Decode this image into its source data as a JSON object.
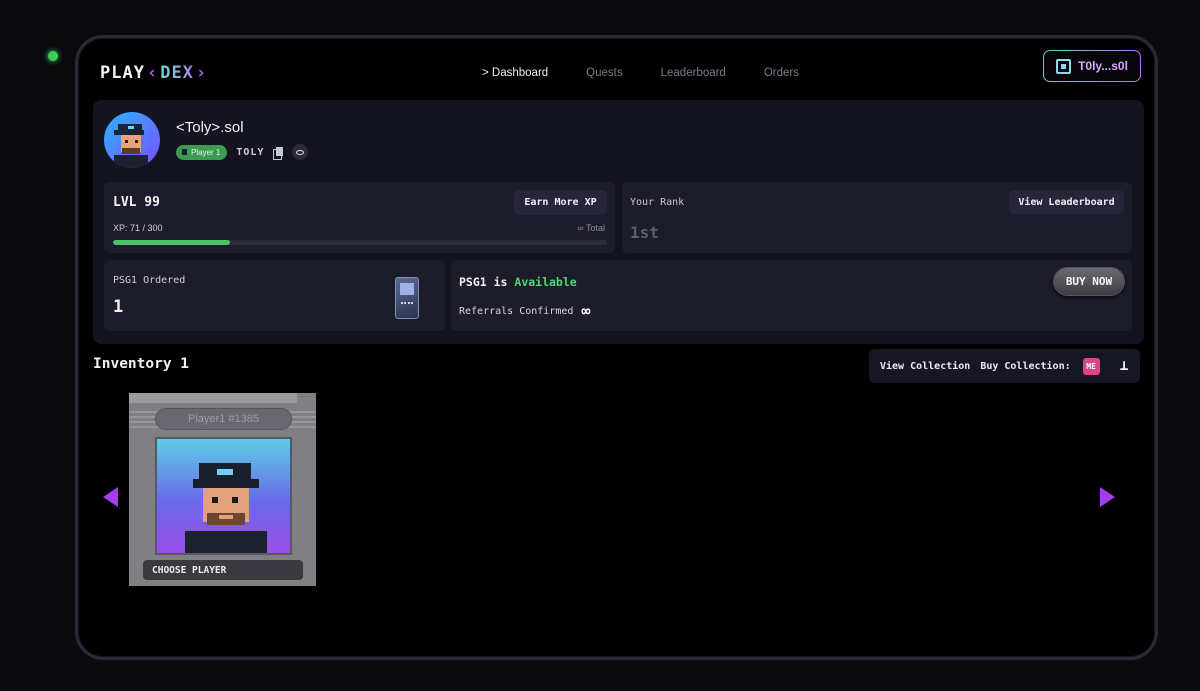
{
  "app": {
    "logo_left": "PLAY",
    "logo_right": "DEX"
  },
  "nav": {
    "items": [
      {
        "label": "> Dashboard",
        "active": true
      },
      {
        "label": "Quests",
        "active": false
      },
      {
        "label": "Leaderboard",
        "active": false
      },
      {
        "label": "Orders",
        "active": false
      }
    ]
  },
  "wallet": {
    "label": "T0ly...s0l",
    "icon": "wallet-icon"
  },
  "profile": {
    "username": "<Toly>.sol",
    "badge": "Player 1",
    "handle": "TOLY"
  },
  "level_card": {
    "level": "LVL 99",
    "earn_button": "Earn More XP",
    "xp": "XP: 71 / 300",
    "total": "∞ Total",
    "progress_fraction": 0.237
  },
  "rank_card": {
    "label": "Your Rank",
    "value": "1st",
    "button": "View Leaderboard"
  },
  "psg_card": {
    "label": "PSG1 Ordered",
    "value": "1"
  },
  "availability_card": {
    "title_prefix": "PSG1 is ",
    "title_status": "Available",
    "referrals_label": "Referrals Confirmed",
    "referrals_value": "∞",
    "buy_button": "BUY NOW"
  },
  "inventory": {
    "title": "Inventory 1",
    "view_collection": "View Collection",
    "buy_collection": "Buy Collection:",
    "marketplace_icons": [
      "magic-eden-icon",
      "tensor-icon"
    ],
    "items": [
      {
        "name": "Player1 #1385",
        "action": "CHOOSE PLAYER"
      }
    ]
  },
  "colors": {
    "accent_green": "#4fc366",
    "accent_purple": "#a43ee8",
    "panel_bg": "#141320"
  }
}
